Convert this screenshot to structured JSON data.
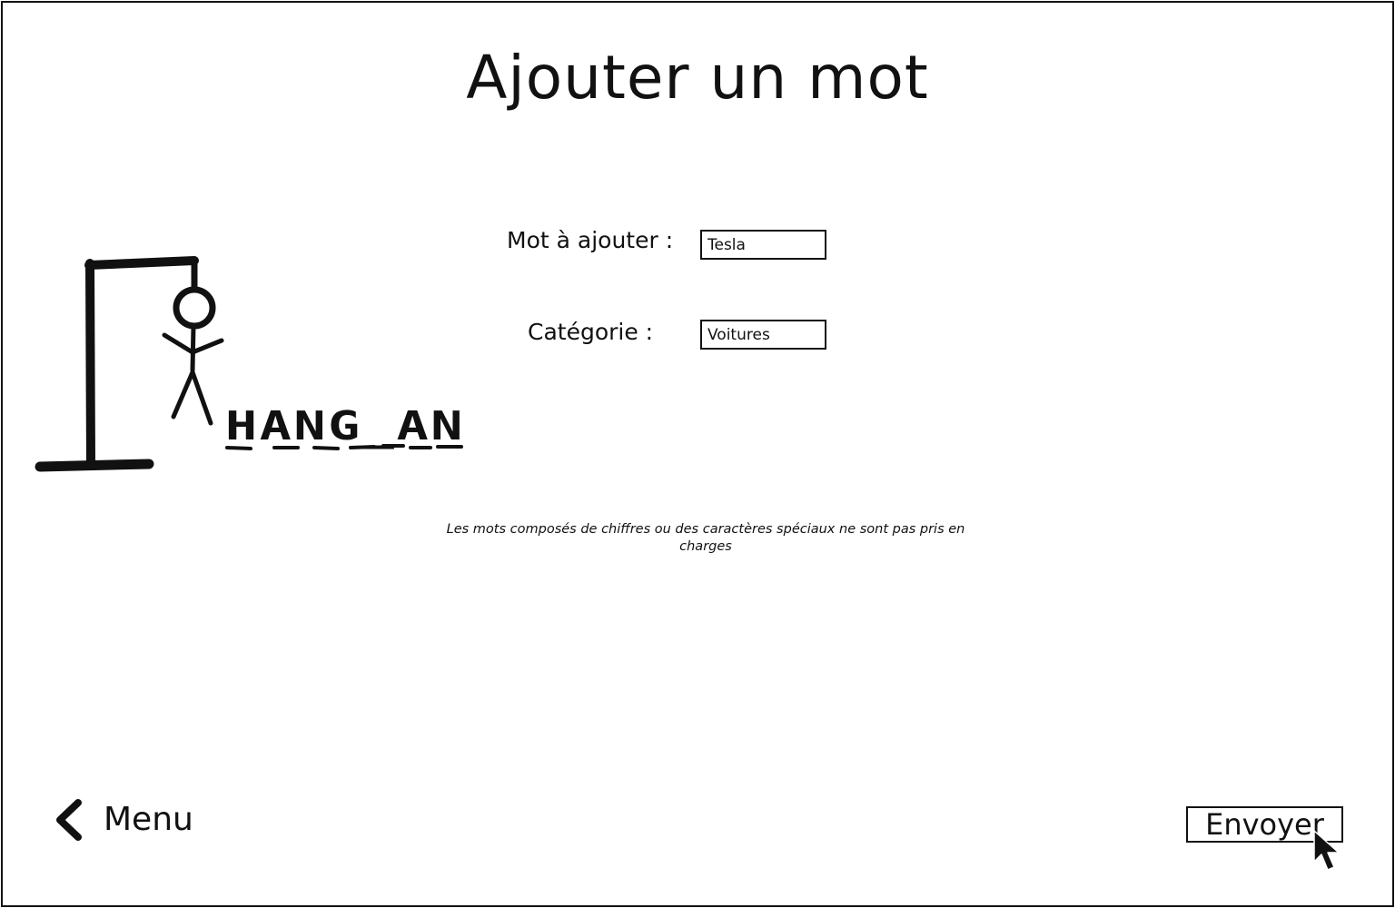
{
  "page": {
    "title": "Ajouter un mot"
  },
  "form": {
    "word_label": "Mot à ajouter :",
    "word_value": "Tesla",
    "category_label": "Catégorie :",
    "category_value": "Voitures",
    "note": "Les mots composés de chiffres ou des caractères spéciaux ne sont pas pris en charges"
  },
  "logo": {
    "text": "HANG_AN",
    "icon": "hangman-gallows-icon"
  },
  "nav": {
    "back_label": "Menu",
    "back_icon": "chevron-left-icon"
  },
  "actions": {
    "send_label": "Envoyer"
  },
  "pointer": {
    "icon": "mouse-cursor-icon"
  },
  "colors": {
    "ink": "#111111",
    "background": "#ffffff"
  }
}
